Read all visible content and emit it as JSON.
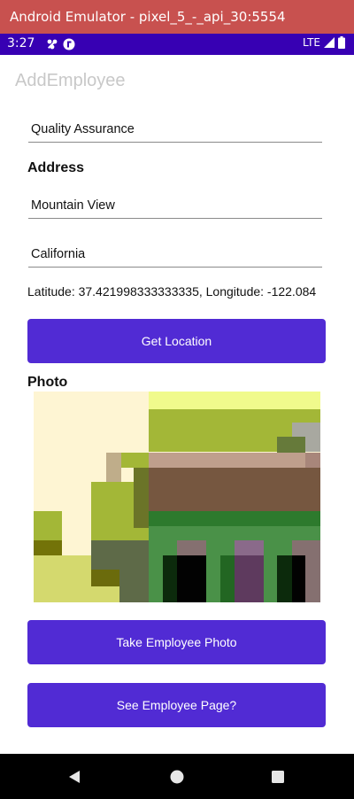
{
  "window": {
    "title": "Android Emulator - pixel_5_-_api_30:5554"
  },
  "status_bar": {
    "time": "3:27",
    "network": "LTE"
  },
  "app": {
    "title": "AddEmployee"
  },
  "form": {
    "department_value": "Quality Assurance",
    "address_heading": "Address",
    "city_value": "Mountain View",
    "state_value": "California",
    "location_text": "Latitude: 37.421998333333335, Longitude: -122.084",
    "get_location_label": "Get Location",
    "photo_heading": "Photo",
    "take_photo_label": "Take Employee Photo",
    "see_page_label": "See Employee Page?"
  },
  "navigation": {
    "back_icon": "back-triangle-icon",
    "home_icon": "home-circle-icon",
    "recents_icon": "recents-square-icon"
  },
  "colors": {
    "title_bar": "#c8514f",
    "status_bar": "#3700b3",
    "button": "#512bd4",
    "app_title": "#c8c8c8"
  }
}
